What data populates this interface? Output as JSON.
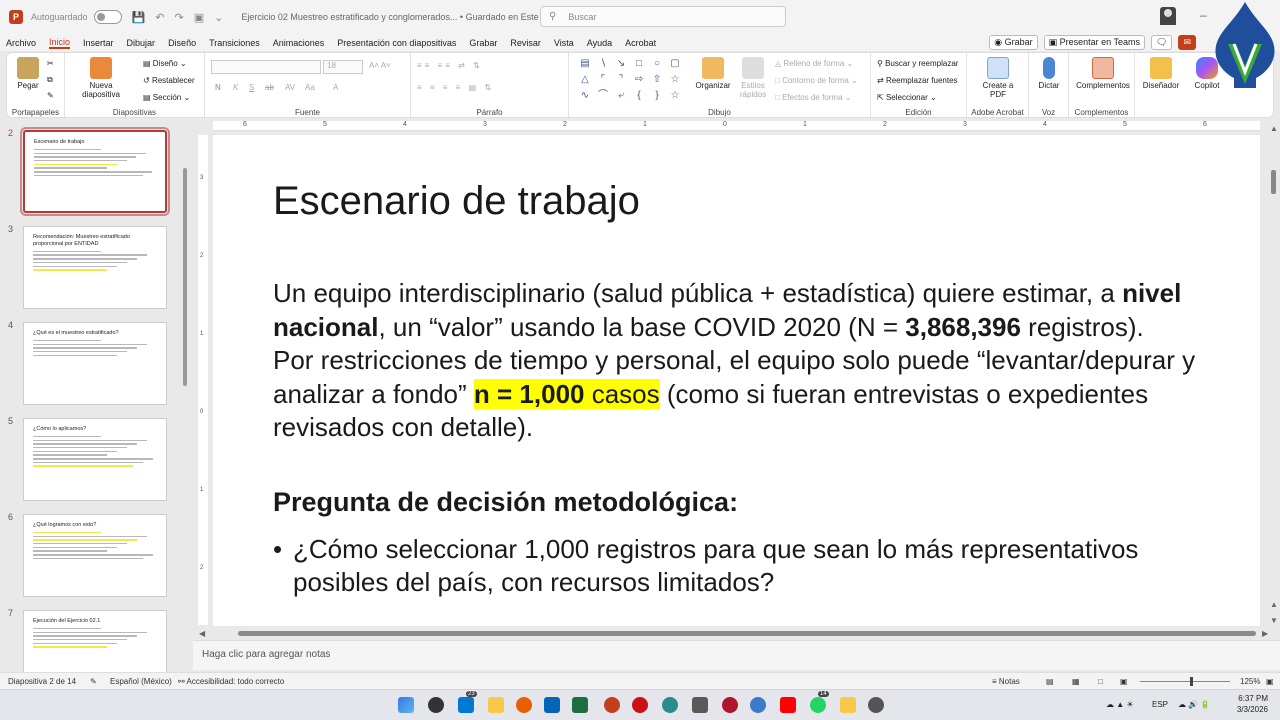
{
  "titlebar": {
    "app_icon": "P",
    "autosave_label": "Autoguardado",
    "document_title": "Ejercicio 02 Muestreo estratificado y conglomerados... • Guardado en Este PC ⌄",
    "search_placeholder": "Buscar"
  },
  "menu": {
    "items": [
      "Archivo",
      "Inicio",
      "Insertar",
      "Dibujar",
      "Diseño",
      "Transiciones",
      "Animaciones",
      "Presentación con diapositivas",
      "Grabar",
      "Revisar",
      "Vista",
      "Ayuda",
      "Acrobat"
    ],
    "active": "Inicio",
    "record_button": "Grabar",
    "teams_button": "Presentar en Teams"
  },
  "ribbon": {
    "clipboard": {
      "paste": "Pegar",
      "label": "Portapapeles"
    },
    "slides": {
      "new_slide": "Nueva diapositiva",
      "design": "Diseño",
      "reset": "Restablecer",
      "section": "Sección",
      "label": "Diapositivas"
    },
    "font": {
      "size": "18",
      "label": "Fuente",
      "format_buttons": [
        "N",
        "K",
        "S",
        "ab",
        "AV",
        "Aa"
      ]
    },
    "paragraph": {
      "label": "Párrafo"
    },
    "drawing": {
      "arrange": "Organizar",
      "quick_styles": "Estilos rápidos",
      "fill": "Relleno de forma",
      "outline": "Contorno de forma",
      "effects": "Efectos de forma",
      "label": "Dibujo"
    },
    "editing": {
      "find": "Buscar y reemplazar",
      "replace_fonts": "Reemplazar fuentes",
      "select": "Seleccionar",
      "label": "Edición"
    },
    "acrobat": {
      "create_pdf": "Create a PDF",
      "label": "Adobe Acrobat"
    },
    "voice": {
      "dictate": "Dictar",
      "label": "Voz"
    },
    "addins": {
      "addins": "Complementos",
      "label": "Complementos"
    },
    "designer": "Diseñador",
    "copilot": "Copilot"
  },
  "thumbnails": [
    {
      "number": "2",
      "title": "Escenario de trabajo",
      "lines": 8,
      "highlight": [
        4
      ]
    },
    {
      "number": "3",
      "title": "Recomendación: Muestreo estratificado proporcional por ENTIDAD",
      "lines": 6,
      "highlight": [
        5
      ]
    },
    {
      "number": "4",
      "title": "¿Qué es el muestreo estratificado?",
      "lines": 5,
      "highlight": []
    },
    {
      "number": "5",
      "title": "¿Cómo lo aplicamos?",
      "lines": 9,
      "highlight": [
        8
      ]
    },
    {
      "number": "6",
      "title": "¿Qué logramos con esto?",
      "lines": 8,
      "highlight": [
        0,
        2
      ]
    },
    {
      "number": "7",
      "title": "Ejecución del Ejercicio 02.1",
      "lines": 6,
      "highlight": [
        5
      ]
    }
  ],
  "slide": {
    "title": "Escenario de trabajo",
    "p1_a": "Un equipo interdisciplinario (salud pública + estadística) quiere estimar, a ",
    "p1_b": "nivel nacional",
    "p1_c": ", un “valor” usando la base COVID 2020 (N = ",
    "p1_d": "3,868,396",
    "p1_e": " registros).",
    "p2_a": "Por restricciones de tiempo y personal, el equipo solo puede “levantar/depurar y analizar a fondo” ",
    "p2_hl_bold": "n = 1,000",
    "p2_hl": " casos",
    "p2_b": " (como si fueran entrevistas o expedientes revisados con detalle).",
    "question_heading": "Pregunta de decisión metodológica:",
    "bullet": "¿Cómo seleccionar 1,000 registros para que sean lo más representativos posibles del país, con recursos limitados?"
  },
  "notes_placeholder": "Haga clic para agregar notas",
  "statusbar": {
    "slide_count": "Diapositiva 2 de 14",
    "language": "Español (México)",
    "accessibility": "Accesibilidad: todo correcto",
    "notes": "Notas",
    "zoom": "125%"
  },
  "taskbar": {
    "lang": "ESP",
    "time": "6:37 PM",
    "date": "3/3/2026",
    "badge_a": "23",
    "badge_b": "14"
  },
  "colors": {
    "accent": "#c43e1c",
    "highlight": "#ffff00",
    "logo_blue": "#1f4e9c",
    "logo_green": "#3aaa35"
  }
}
